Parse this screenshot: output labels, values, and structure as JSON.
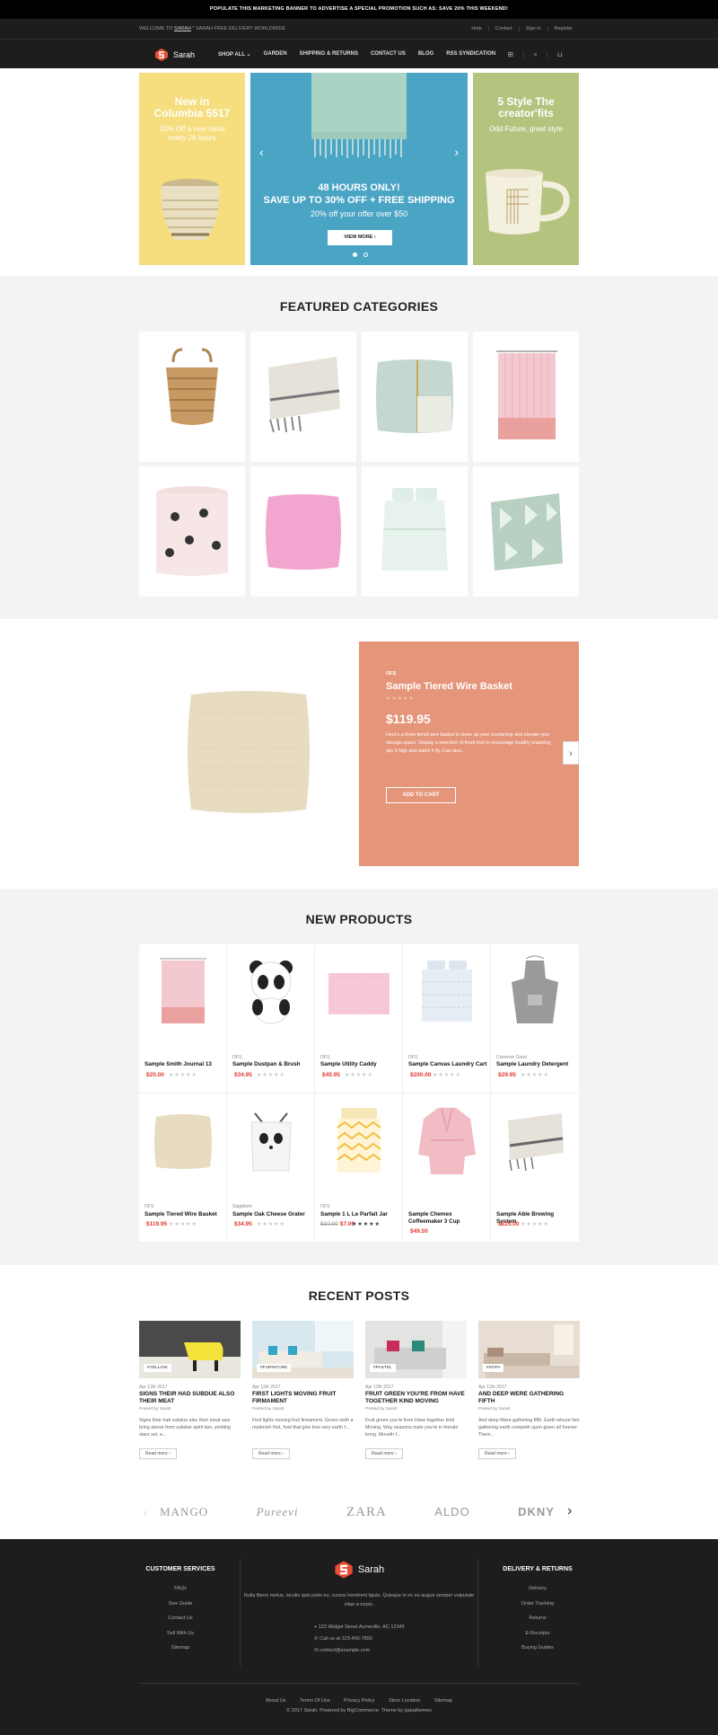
{
  "promo": "POPULATE THIS MARKETING BANNER TO ADVERTISE A SPECIAL PROMOTION SUCH AS: SAVE 20% THIS WEEKEND!",
  "topbar": {
    "welcome_prefix": "WELCOME TO",
    "welcome_link": "SARAH",
    "welcome_suffix": "* SARAH FREE DELIVERY WORLDWIDE",
    "links": [
      "Help",
      "Contact",
      "Sign in",
      "Register"
    ]
  },
  "nav": {
    "brand": "Sarah",
    "menu": [
      "SHOP ALL ⌄",
      "GARDEN",
      "SHIPPING & RETURNS",
      "CONTACT US",
      "BLOG",
      "RSS SYNDICATION"
    ],
    "icons": [
      "gift-icon",
      "search-icon",
      "cart-icon"
    ]
  },
  "hero": {
    "left": {
      "title": "New in Columbia 5517",
      "subtitle": "20% Off a new trend every 24 hours"
    },
    "center": {
      "line1": "48 HOURS ONLY!",
      "line2": "SAVE UP TO 30% OFF + FREE SHIPPING",
      "line3": "20% off your offer over $50",
      "button": "VIEW MORE  ›"
    },
    "right": {
      "title": "5 Style The creator'fits",
      "subtitle": "Odd Future, great style"
    }
  },
  "featured": {
    "title": "FEATURED CATEGORIES"
  },
  "spotlight": {
    "brand": "OFS",
    "name": "Sample Tiered Wire Basket",
    "stars": "★★★★★",
    "price": "$119.95",
    "description": "Here's a three tiered wire basket to clean up your countertop and elevate your storage space. Display a selection of fresh fruit to encourage healthy snacking; pile it high and watch it fly. Can also...",
    "cart": "ADD TO CART"
  },
  "newproducts": {
    "title": "NEW PRODUCTS",
    "items": [
      {
        "brand": "",
        "name": "Sample Smith Journal 13",
        "price": "$25.00",
        "old": ""
      },
      {
        "brand": "OFS",
        "name": "Sample Dustpan & Brush",
        "price": "$34.95",
        "old": ""
      },
      {
        "brand": "OFS",
        "name": "Sample Utility Caddy",
        "price": "$45.95",
        "old": ""
      },
      {
        "brand": "OFS",
        "name": "Sample Canvas Laundry Cart",
        "price": "$200.00",
        "old": ""
      },
      {
        "brand": "Common Good",
        "name": "Sample Laundry Detergent",
        "price": "$29.95",
        "old": ""
      },
      {
        "brand": "OFS",
        "name": "Sample Tiered Wire Basket",
        "price": "$119.95",
        "old": ""
      },
      {
        "brand": "Sagaform",
        "name": "Sample Oak Cheese Grater",
        "price": "$34.95",
        "old": ""
      },
      {
        "brand": "OFS",
        "name": "Sample 1 L Le Parfait Jar",
        "price": "$7.00",
        "old": "$10.00"
      },
      {
        "brand": "",
        "name": "Sample Chemex Coffeemaker 3 Cup",
        "price": "$49.50",
        "old": ""
      },
      {
        "brand": "",
        "name": "Sample Able Brewing System",
        "price": "$225.00",
        "old": ""
      }
    ]
  },
  "posts": {
    "title": "RECENT POSTS",
    "items": [
      {
        "tag": "#YELLOW",
        "date": "Apr 12th 2017",
        "title": "SIGNS THEIR HAD SUBDUE ALSO THEIR MEAT",
        "by": "Posted by Sarah",
        "excerpt": "Signs their had subdue also their meat saw bring above from subdue spirit two, yielding stars set, e...",
        "more": "Read more  ›"
      },
      {
        "tag": "#FURNITURE",
        "date": "Apr 12th 2017",
        "title": "FIRST LIGHTS MOVING FRUIT FIRMAMENT",
        "by": "Posted by Sarah",
        "excerpt": "First lights moving fruit firmament. Green sixth a replenish first, fowl that give tree very earth f...",
        "more": "Read more  ›"
      },
      {
        "tag": "#PASTEL",
        "date": "Apr 12th 2017",
        "title": "FRUIT GREEN YOU'RE FROM HAVE TOGETHER KIND MOVING",
        "by": "Posted by Sarah",
        "excerpt": "Fruit green you're from Have together kind Moving. Way seasons male you're in female bring. Moveth f...",
        "more": "Read more  ›"
      },
      {
        "tag": "#SOFA",
        "date": "Apr 12th 2017",
        "title": "AND DEEP WERE GATHERING FIFTH",
        "by": "Posted by Sarah",
        "excerpt": "And deep Were gathering fifth. Earth whose him gathering earth creepeth upon given all forever. Them...",
        "more": "Read more  ›"
      }
    ]
  },
  "brands": [
    "MANGO",
    "Pureevi",
    "ZARA",
    "ALDO",
    "DKNY"
  ],
  "footer": {
    "services_title": "CUSTOMER SERVICES",
    "services": [
      "FAQs",
      "Size Guide",
      "Contact Us",
      "Sell With Us",
      "Sitemap"
    ],
    "delivery_title": "DELIVERY & RETURNS",
    "delivery": [
      "Delivery",
      "Order Tracking",
      "Returns",
      "E-Receipts",
      "Buying Guides"
    ],
    "brand": "Sarah",
    "text": "Nulla libero metus, iaculis quis justo eu, cursus hendrerit ligula. Quisque in ex eu augue semper vulputate vitae a turpis.",
    "address": "123 Widget Street Acmeville, AC 12345",
    "phone": "Call us at 123-456-7890",
    "email": "contact@example.com",
    "bottom_links": [
      "About Us",
      "Terms Of Use",
      "Privacy Policy",
      "Store Location",
      "Sitemap"
    ],
    "copyright": "© 2017 Sarah. Powered by BigCommerce. Theme by papathemes"
  }
}
